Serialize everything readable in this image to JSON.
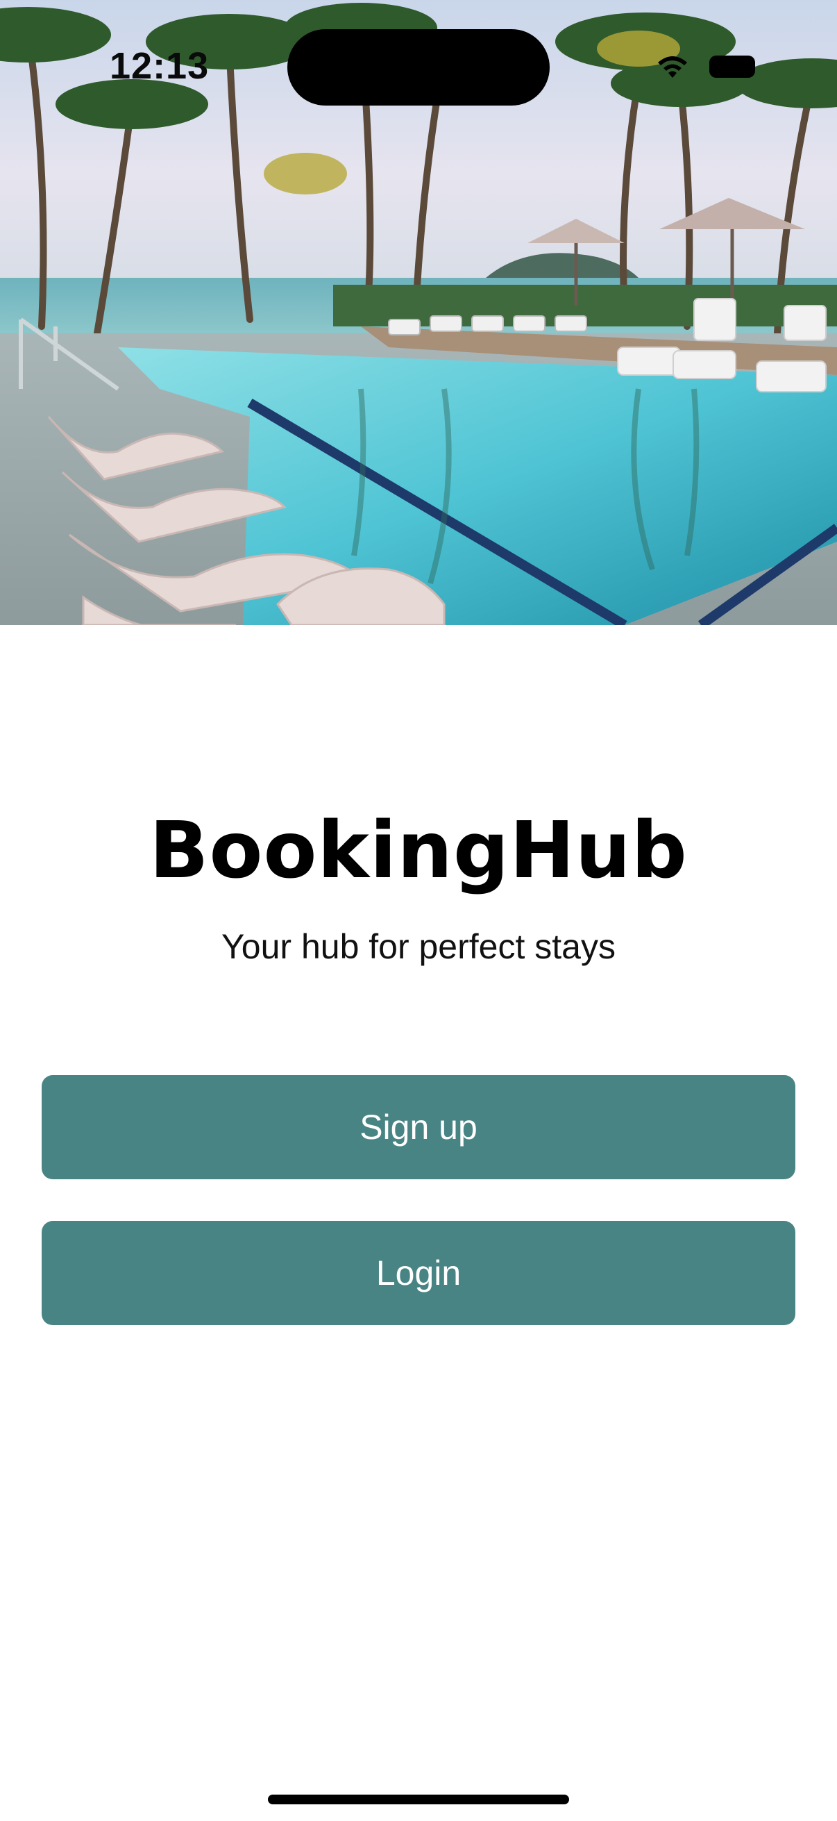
{
  "status_bar": {
    "time": "12:13",
    "icons": [
      "wifi-icon",
      "battery-icon"
    ]
  },
  "hero": {
    "image": "resort-pool-photo",
    "description_icon": "hero-image"
  },
  "app": {
    "title": "BookingHub",
    "tagline": "Your hub for perfect stays"
  },
  "actions": {
    "signup_label": "Sign up",
    "login_label": "Login"
  },
  "colors": {
    "button_bg": "#498484",
    "button_text": "#ffffff",
    "background": "#ffffff",
    "title": "#000000"
  }
}
